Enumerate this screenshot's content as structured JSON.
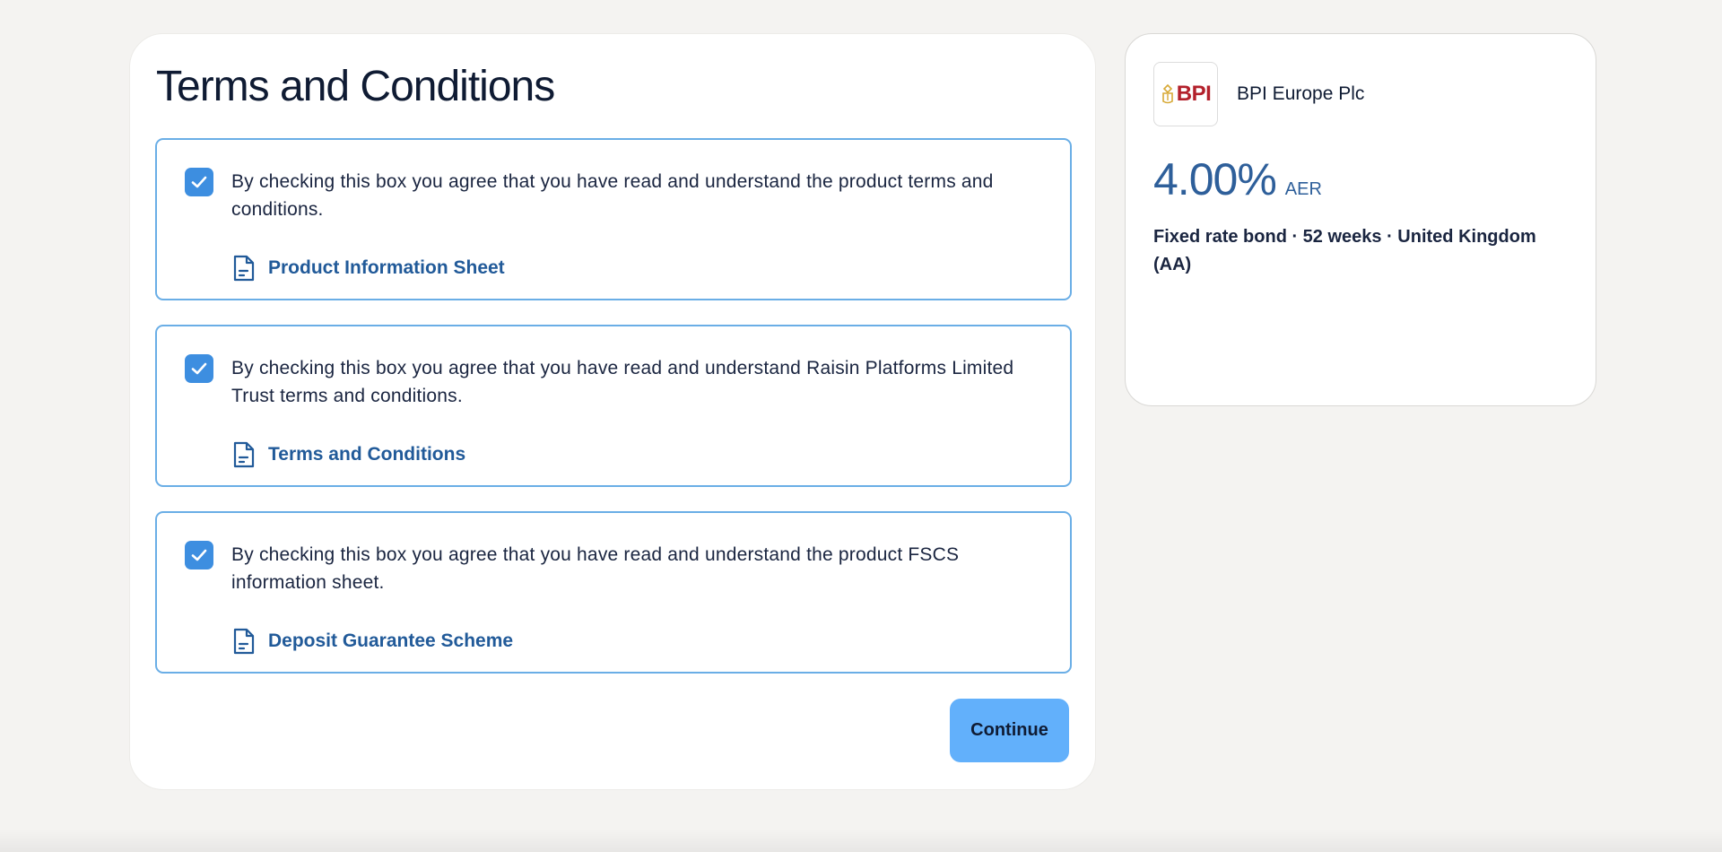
{
  "page": {
    "title": "Terms and Conditions"
  },
  "agreements": [
    {
      "checked": true,
      "text": "By checking this box you agree that you have read and understand the product terms and conditions.",
      "link_label": "Product Information Sheet",
      "link_icon": "document-icon"
    },
    {
      "checked": true,
      "text": "By checking this box you agree that you have read and understand Raisin Platforms Limited Trust terms and conditions.",
      "link_label": "Terms and Conditions",
      "link_icon": "document-icon"
    },
    {
      "checked": true,
      "text": "By checking this box you agree that you have read and understand the product FSCS information sheet.",
      "link_label": "Deposit Guarantee Scheme",
      "link_icon": "document-icon"
    }
  ],
  "actions": {
    "continue_label": "Continue"
  },
  "offer": {
    "logo_text": "BPI",
    "bank_name": "BPI Europe Plc",
    "rate": "4.00%",
    "rate_unit": "AER",
    "description": "Fixed rate bond · 52 weeks · United Kingdom (AA)"
  },
  "colors": {
    "accent": "#3d8ee0",
    "button": "#62b0fb",
    "link": "#215a99",
    "box_border": "#6aaee6",
    "logo_red": "#b3202b",
    "logo_gold": "#d7a936"
  }
}
